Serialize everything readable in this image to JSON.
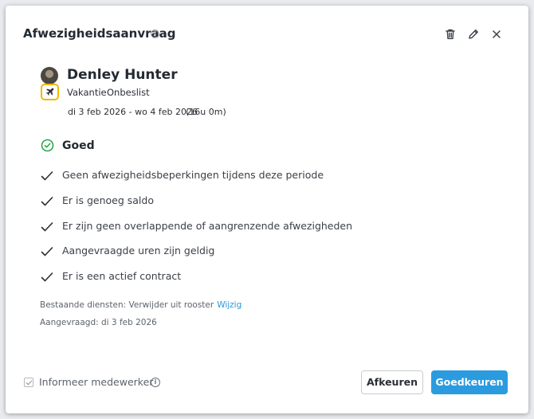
{
  "dialog": {
    "title": "Afwezigheidsaanvraag",
    "help_glyph": "?"
  },
  "request": {
    "employee_name": "Denley Hunter",
    "leave_type": "Vakantie",
    "status": "Onbeslist",
    "date_range": "di 3 feb 2026 - wo 4 feb 2026",
    "duration": "(16u 0m)",
    "type_icon": "airplane-icon"
  },
  "validation": {
    "summary": "Goed",
    "checks": [
      "Geen afwezigheidsbeperkingen tijdens deze periode",
      "Er is genoeg saldo",
      "Er zijn geen overlappende of aangrenzende afwezigheden",
      "Aangevraagde uren zijn geldig",
      "Er is een actief contract"
    ]
  },
  "meta": {
    "existing_shifts": "Bestaande diensten: Verwijder uit rooster",
    "edit_link": "Wijzig",
    "requested_on": "Aangevraagd: di 3 feb 2026"
  },
  "footer": {
    "notify_label": "Informeer medewerker",
    "notify_checked": true,
    "info_glyph": "i",
    "reject_label": "Afkeuren",
    "approve_label": "Goedkeuren"
  },
  "colors": {
    "accent": "#2b9be0",
    "success": "#2aa84a",
    "badge_border": "#f2b705"
  }
}
